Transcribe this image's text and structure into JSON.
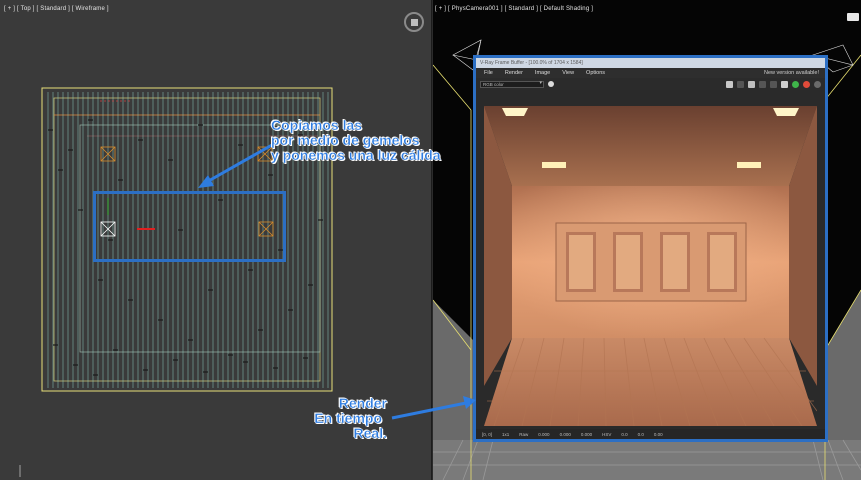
{
  "left_viewport": {
    "label": "[ + ] [ Top ] [ Standard ] [ Wireframe ]"
  },
  "right_viewport": {
    "label": "[ + ] [ PhysCamera001 ] [ Standard ] [ Default Shading ]"
  },
  "vfb": {
    "title": "V-Ray Frame Buffer - [100.0% of 1704 x 1584]",
    "menu": [
      "File",
      "Render",
      "Image",
      "View",
      "Options"
    ],
    "news": "New version available!",
    "channel": "RGB color",
    "status": [
      "[0, 0]",
      "1x1",
      "Raw",
      "0.000",
      "0.000",
      "0.000",
      "HSV",
      "0.0",
      "0.0",
      "0.00"
    ]
  },
  "annotations": {
    "copy_note": [
      "Copiamos las",
      "por medio de gemelos",
      "y ponemos una luz cálida"
    ],
    "render_note": [
      "Render",
      "En tiempo",
      "Real."
    ]
  },
  "colors": {
    "highlight": "#2c6fc4",
    "annotation_text": "#2e7ce0"
  }
}
